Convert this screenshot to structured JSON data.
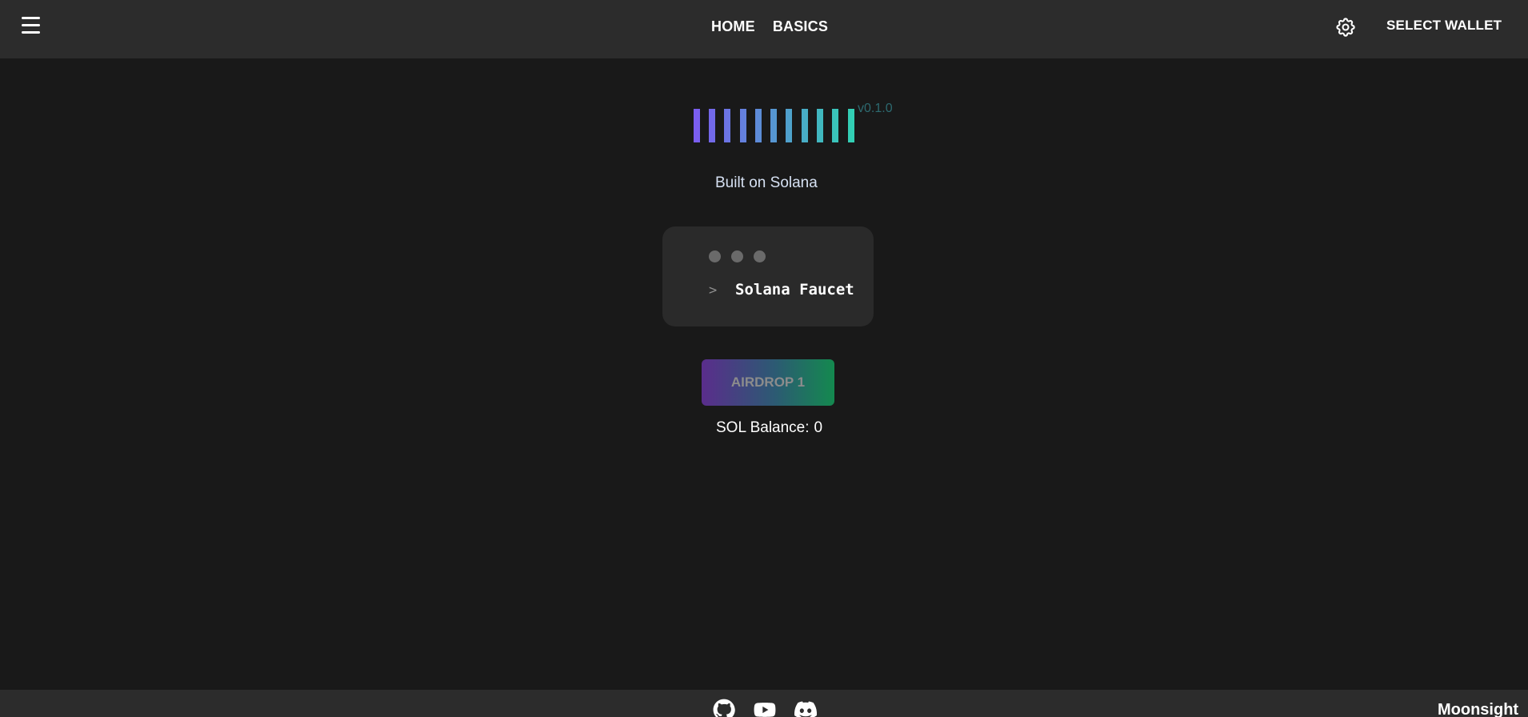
{
  "navbar": {
    "menu_icon": "hamburger-menu-icon",
    "links": [
      {
        "label": "HOME"
      },
      {
        "label": "BASICS"
      }
    ],
    "settings_icon": "gear-icon",
    "wallet_button": "SELECT WALLET"
  },
  "hero": {
    "logo_icon": "solana-bars-logo",
    "version": "v0.1.0",
    "tagline": "Built on Solana"
  },
  "terminal": {
    "prompt": ">",
    "text": "Solana Faucet"
  },
  "airdrop": {
    "button_label": "AIRDROP 1",
    "balance_label": "SOL Balance:",
    "balance_value": "0"
  },
  "footer": {
    "icons": [
      "github-icon",
      "youtube-icon",
      "discord-icon"
    ],
    "brand": "Moonsight"
  },
  "colors": {
    "background": "#191919",
    "bar_background": "#2c2c2c",
    "gradient_start": "#7b5cf0",
    "gradient_end": "#31d1b3",
    "button_start": "#5a2d8c",
    "button_end": "#14894f"
  }
}
